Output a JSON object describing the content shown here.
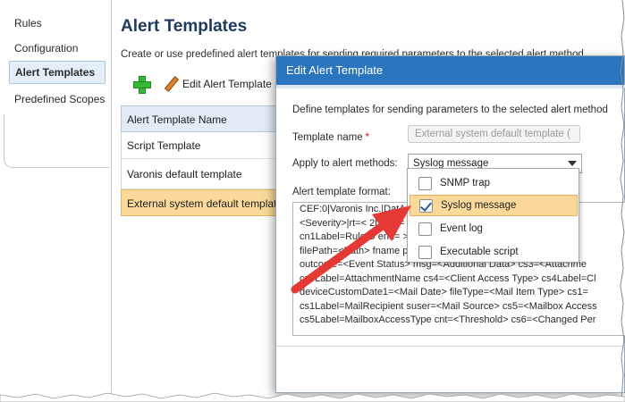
{
  "nav": {
    "items": [
      {
        "label": "Rules"
      },
      {
        "label": "Configuration"
      },
      {
        "label": "Alert Templates"
      },
      {
        "label": "Predefined Scopes"
      }
    ]
  },
  "main": {
    "title": "Alert Templates",
    "description": "Create or use predefined alert templates for sending required parameters to the selected alert method",
    "toolbar": {
      "add_icon": "plus-icon",
      "edit_label": "Edit Alert Template"
    },
    "grid": {
      "header": "Alert Template Name",
      "rows": [
        {
          "name": "Script Template"
        },
        {
          "name": "Varonis default template"
        },
        {
          "name": "External system default template"
        }
      ],
      "selected_row": "External system default template"
    }
  },
  "dialog": {
    "title": "Edit Alert Template",
    "description": "Define templates for sending parameters to the selected alert method",
    "template_name_label": "Template name",
    "required_mark": "*",
    "template_name_value": "External system default template (",
    "apply_label": "Apply to alert methods:",
    "apply_value": "Syslog message",
    "format_label": "Alert template format:",
    "format_lines": [
      "CEF:0|Varonis Inc.|DatA                              Event C",
      "<Severity>|rt=<                                    2Label=",
      "cn1Label=RuleID end=                              > dhost",
      "filePath=<Path> fname                            pe> dvcl",
      "outcome=<Event Status> msg=<Additional Data> cs3=<Attachme",
      "cs3Label=AttachmentName cs4=<Client Access Type> cs4Label=Cl",
      "deviceCustomDate1=<Mail Date> fileType=<Mail Item Type> cs1=",
      "cs1Label=MailRecipient suser=<Mail Source> cs5=<Mailbox Access",
      "cs5Label=MailboxAccessType cnt=<Threshold> cs6=<Changed Per"
    ]
  },
  "dropdown": {
    "options": [
      {
        "label": "SNMP trap",
        "checked": false,
        "highlighted": false
      },
      {
        "label": "Syslog message",
        "checked": true,
        "highlighted": true
      },
      {
        "label": "Event log",
        "checked": false,
        "highlighted": false
      },
      {
        "label": "Executable script",
        "checked": false,
        "highlighted": false
      }
    ]
  },
  "colors": {
    "dialog_title_bar": "#2b75bf",
    "selection_highlight": "#fbd99a",
    "annotation_arrow": "#e53935",
    "required_mark": "#dd1111"
  }
}
